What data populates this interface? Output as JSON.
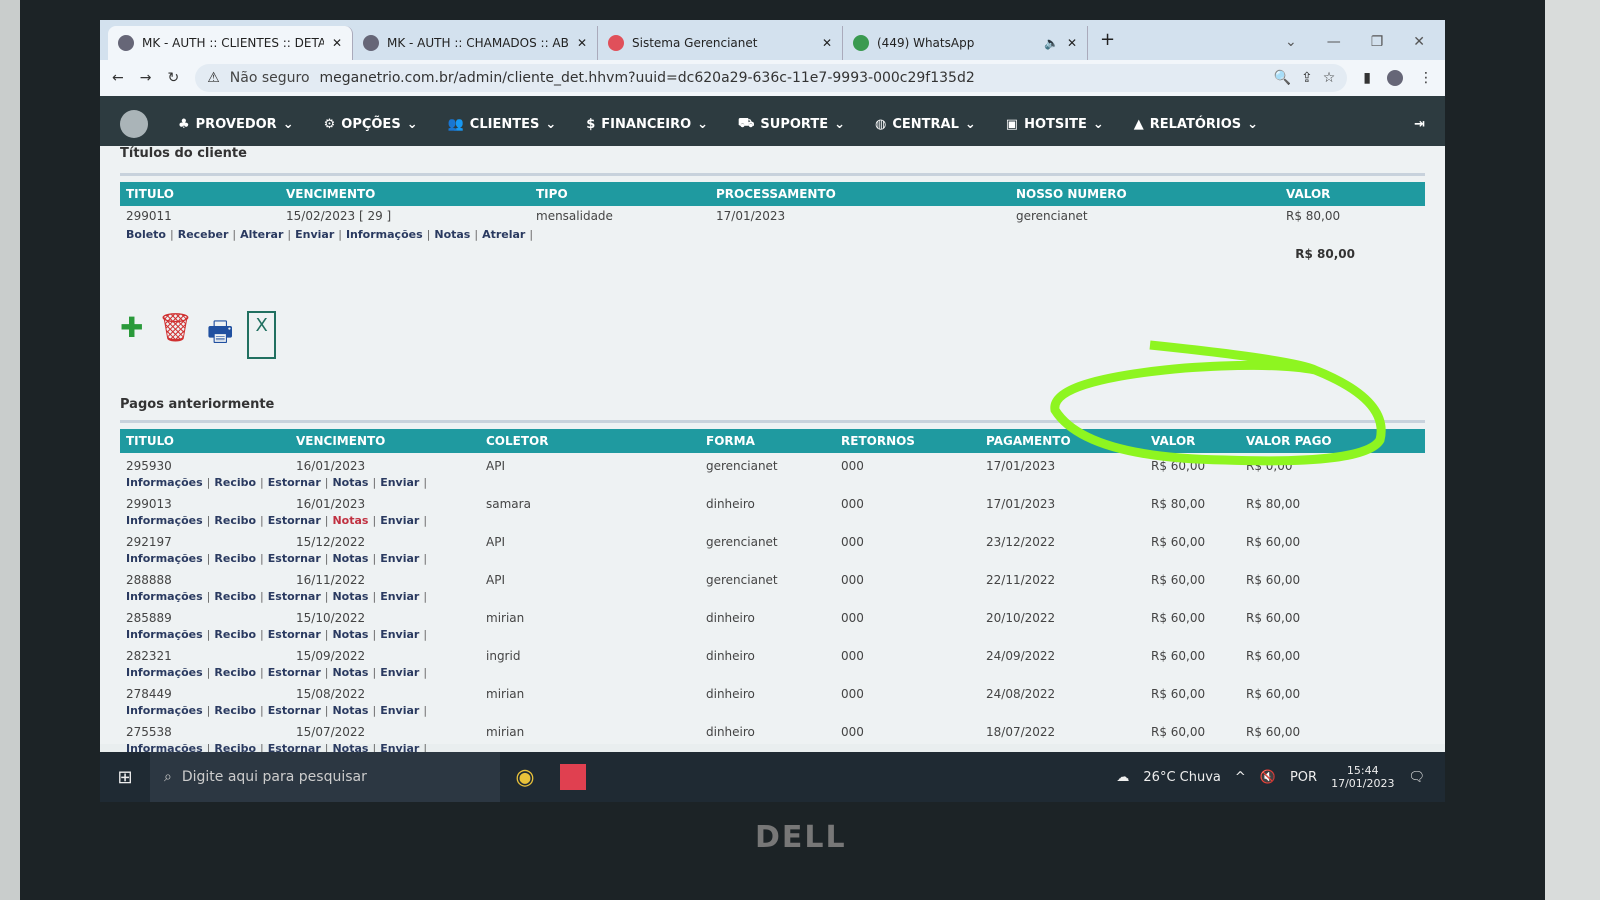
{
  "browser": {
    "tabs": [
      {
        "title": "MK - AUTH :: CLIENTES :: DETALH"
      },
      {
        "title": "MK - AUTH :: CHAMADOS :: ABER"
      },
      {
        "title": "Sistema Gerencianet"
      },
      {
        "title": "(449) WhatsApp"
      }
    ],
    "security": "Não seguro",
    "url": "meganetrio.com.br/admin/cliente_det.hhvm?uuid=dc620a29-636c-11e7-9993-000c29f135d2"
  },
  "nav": [
    "PROVEDOR",
    "OPÇÕES",
    "CLIENTES",
    "FINANCEIRO",
    "SUPORTE",
    "CENTRAL",
    "HOTSITE",
    "RELATÓRIOS"
  ],
  "titulos": {
    "section": "Títulos do cliente",
    "headers": [
      "TITULO",
      "VENCIMENTO",
      "TIPO",
      "PROCESSAMENTO",
      "NOSSO NUMERO",
      "VALOR"
    ],
    "rows": [
      {
        "titulo": "299011",
        "vencimento": "15/02/2023 [ 29 ]",
        "tipo": "mensalidade",
        "processamento": "17/01/2023",
        "nosso_numero": "gerencianet",
        "valor": "R$ 80,00"
      }
    ],
    "actions": [
      "Boleto",
      "Receber",
      "Alterar",
      "Enviar",
      "Informações",
      "Notas",
      "Atrelar"
    ],
    "total": "R$ 80,00"
  },
  "toolbar": {
    "icons": [
      "add-icon",
      "trash-icon",
      "print-icon",
      "excel-icon"
    ]
  },
  "pagos": {
    "section": "Pagos anteriormente",
    "headers": [
      "TITULO",
      "VENCIMENTO",
      "COLETOR",
      "FORMA",
      "RETORNOS",
      "PAGAMENTO",
      "VALOR",
      "VALOR PAGO"
    ],
    "actions": [
      "Informações",
      "Recibo",
      "Estornar",
      "Notas",
      "Enviar"
    ],
    "rows": [
      [
        "295930",
        "16/01/2023",
        "API",
        "gerencianet",
        "000",
        "17/01/2023",
        "R$ 60,00",
        "R$ 0,00"
      ],
      [
        "299013",
        "16/01/2023",
        "samara",
        "dinheiro",
        "000",
        "17/01/2023",
        "R$ 80,00",
        "R$ 80,00"
      ],
      [
        "292197",
        "15/12/2022",
        "API",
        "gerencianet",
        "000",
        "23/12/2022",
        "R$ 60,00",
        "R$ 60,00"
      ],
      [
        "288888",
        "16/11/2022",
        "API",
        "gerencianet",
        "000",
        "22/11/2022",
        "R$ 60,00",
        "R$ 60,00"
      ],
      [
        "285889",
        "15/10/2022",
        "mirian",
        "dinheiro",
        "000",
        "20/10/2022",
        "R$ 60,00",
        "R$ 60,00"
      ],
      [
        "282321",
        "15/09/2022",
        "ingrid",
        "dinheiro",
        "000",
        "24/09/2022",
        "R$ 60,00",
        "R$ 60,00"
      ],
      [
        "278449",
        "15/08/2022",
        "mirian",
        "dinheiro",
        "000",
        "24/08/2022",
        "R$ 60,00",
        "R$ 60,00"
      ],
      [
        "275538",
        "15/07/2022",
        "mirian",
        "dinheiro",
        "000",
        "18/07/2022",
        "R$ 60,00",
        "R$ 60,00"
      ]
    ]
  },
  "taskbar": {
    "search_placeholder": "Digite aqui para pesquisar",
    "weather": "26°C Chuva",
    "lang": "POR",
    "time": "15:44",
    "date": "17/01/2023"
  },
  "brand": "DELL",
  "colors": {
    "header": "#1f9aa0",
    "nav": "#2d3b40",
    "annotation": "#8ef520"
  }
}
